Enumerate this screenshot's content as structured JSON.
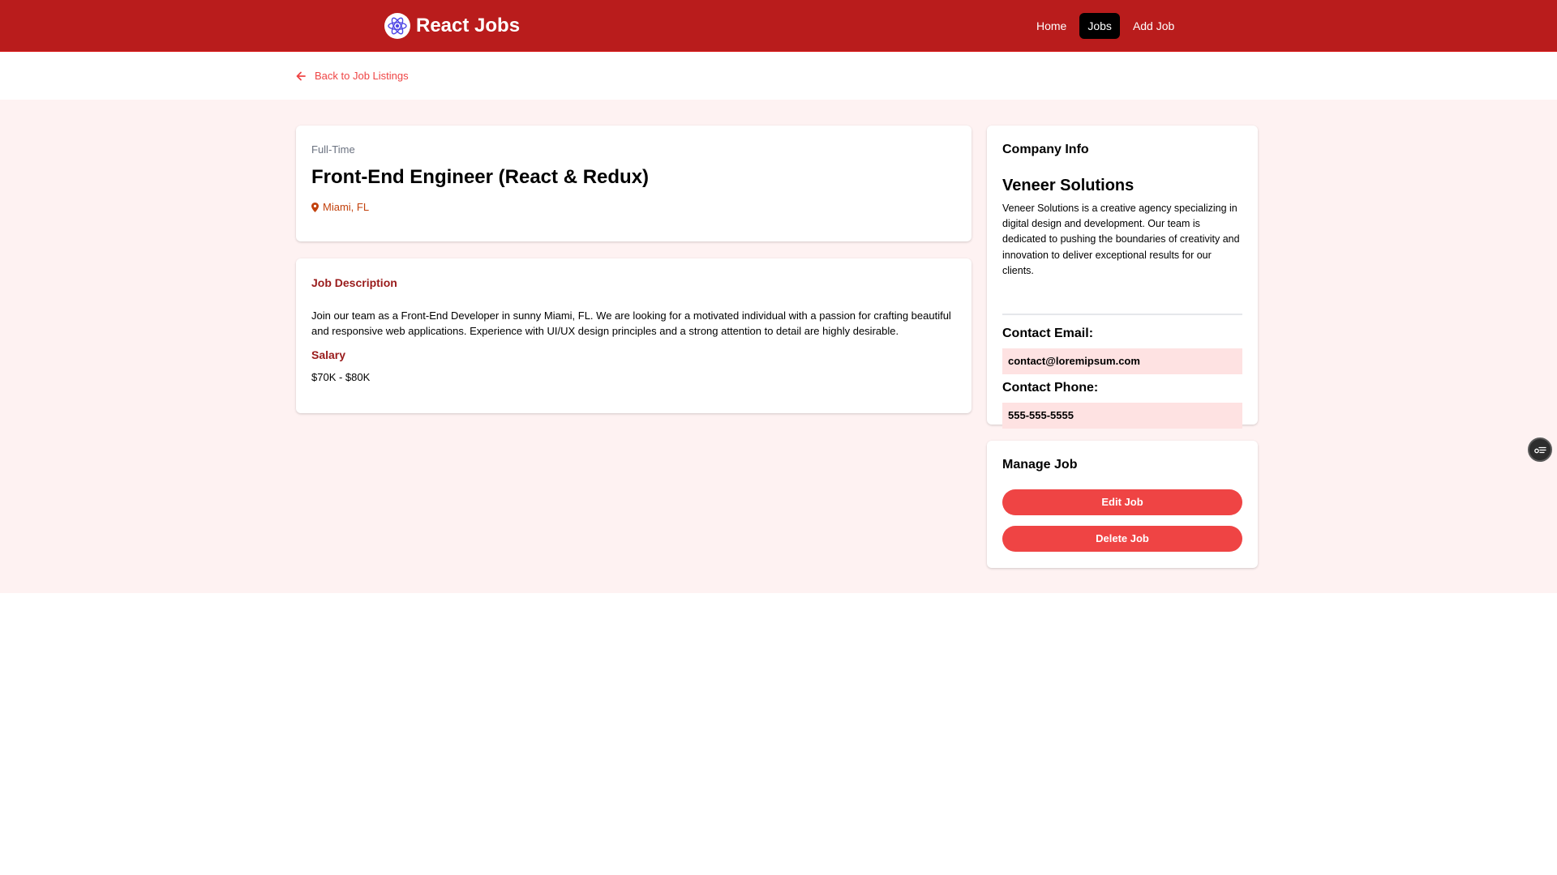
{
  "navbar": {
    "brand": "React Jobs",
    "links": [
      {
        "label": "Home",
        "active": false
      },
      {
        "label": "Jobs",
        "active": true
      },
      {
        "label": "Add Job",
        "active": false
      }
    ]
  },
  "back_link": {
    "label": "Back to Job Listings",
    "icon": "arrow-left-icon"
  },
  "job": {
    "type": "Full-Time",
    "title": "Front-End Engineer (React & Redux)",
    "location": "Miami, FL",
    "description_heading": "Job Description",
    "description": "Join our team as a Front-End Developer in sunny Miami, FL. We are looking for a motivated individual with a passion for crafting beautiful and responsive web applications. Experience with UI/UX design principles and a strong attention to detail are highly desirable.",
    "salary_heading": "Salary",
    "salary": "$70K - $80K"
  },
  "company": {
    "heading": "Company Info",
    "name": "Veneer Solutions",
    "description": "Veneer Solutions is a creative agency specializing in digital design and development. Our team is dedicated to pushing the boundaries of creativity and innovation to deliver exceptional results for our clients.",
    "email_label": "Contact Email:",
    "email": "contact@loremipsum.com",
    "phone_label": "Contact Phone:",
    "phone": "555-555-5555"
  },
  "manage": {
    "heading": "Manage Job",
    "edit_label": "Edit Job",
    "delete_label": "Delete Job"
  },
  "colors": {
    "navbar": "#b91c1c",
    "accent": "#ef4444",
    "page_bg": "#fef2f2",
    "heading_red": "#991b1b",
    "location": "#c2410c",
    "contact_bg": "#fee2e2"
  }
}
